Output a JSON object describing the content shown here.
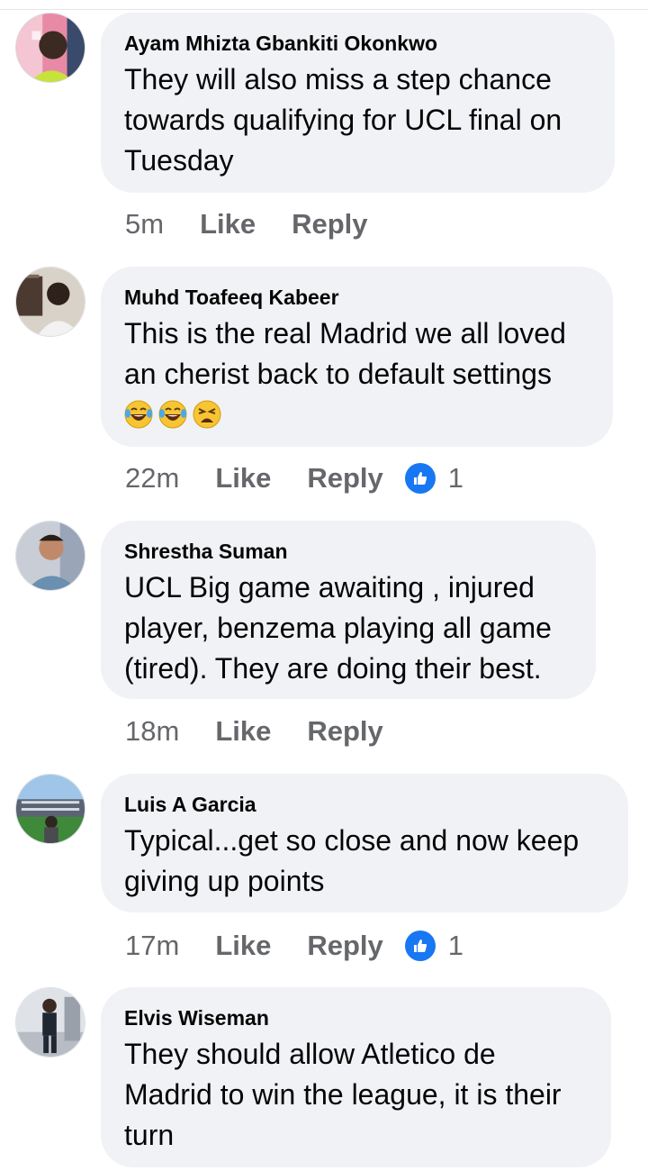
{
  "comments": [
    {
      "author": "Ayam Mhizta Gbankiti Okonkwo",
      "lines": [
        "They will also miss a step chance",
        "towards qualifying for UCL final on",
        "Tuesday"
      ],
      "time": "5m",
      "like_label": "Like",
      "reply_label": "Reply",
      "avatar_icon": "person-avatar",
      "reactions": null
    },
    {
      "author": "Muhd Toafeeq Kabeer",
      "lines": [
        "This is the real Madrid we all loved",
        "an cherist back to default settings"
      ],
      "emojis": [
        "tears-of-joy-emoji",
        "tears-of-joy-emoji",
        "tired-face-emoji"
      ],
      "time": "22m",
      "like_label": "Like",
      "reply_label": "Reply",
      "avatar_icon": "person-avatar",
      "reactions": {
        "icon": "thumbs-up-icon",
        "count": "1"
      }
    },
    {
      "author": "Shrestha Suman",
      "lines": [
        "UCL Big game awaiting , injured",
        "player, benzema playing all game",
        "(tired). They are doing their best."
      ],
      "time": "18m",
      "like_label": "Like",
      "reply_label": "Reply",
      "avatar_icon": "person-avatar",
      "reactions": null
    },
    {
      "author": "Luis A Garcia",
      "lines": [
        "Typical...get so close and now keep",
        "giving up points"
      ],
      "time": "17m",
      "like_label": "Like",
      "reply_label": "Reply",
      "avatar_icon": "stadium-avatar",
      "reactions": {
        "icon": "thumbs-up-icon",
        "count": "1"
      }
    },
    {
      "author": "Elvis Wiseman",
      "lines": [
        "They should allow Atletico de",
        "Madrid to win the league, it is their",
        "turn"
      ],
      "avatar_icon": "person-avatar",
      "reactions": null
    }
  ],
  "colors": {
    "bubble": "#f0f2f5",
    "meta_text": "#65676b",
    "like_badge": "#1877f2"
  }
}
